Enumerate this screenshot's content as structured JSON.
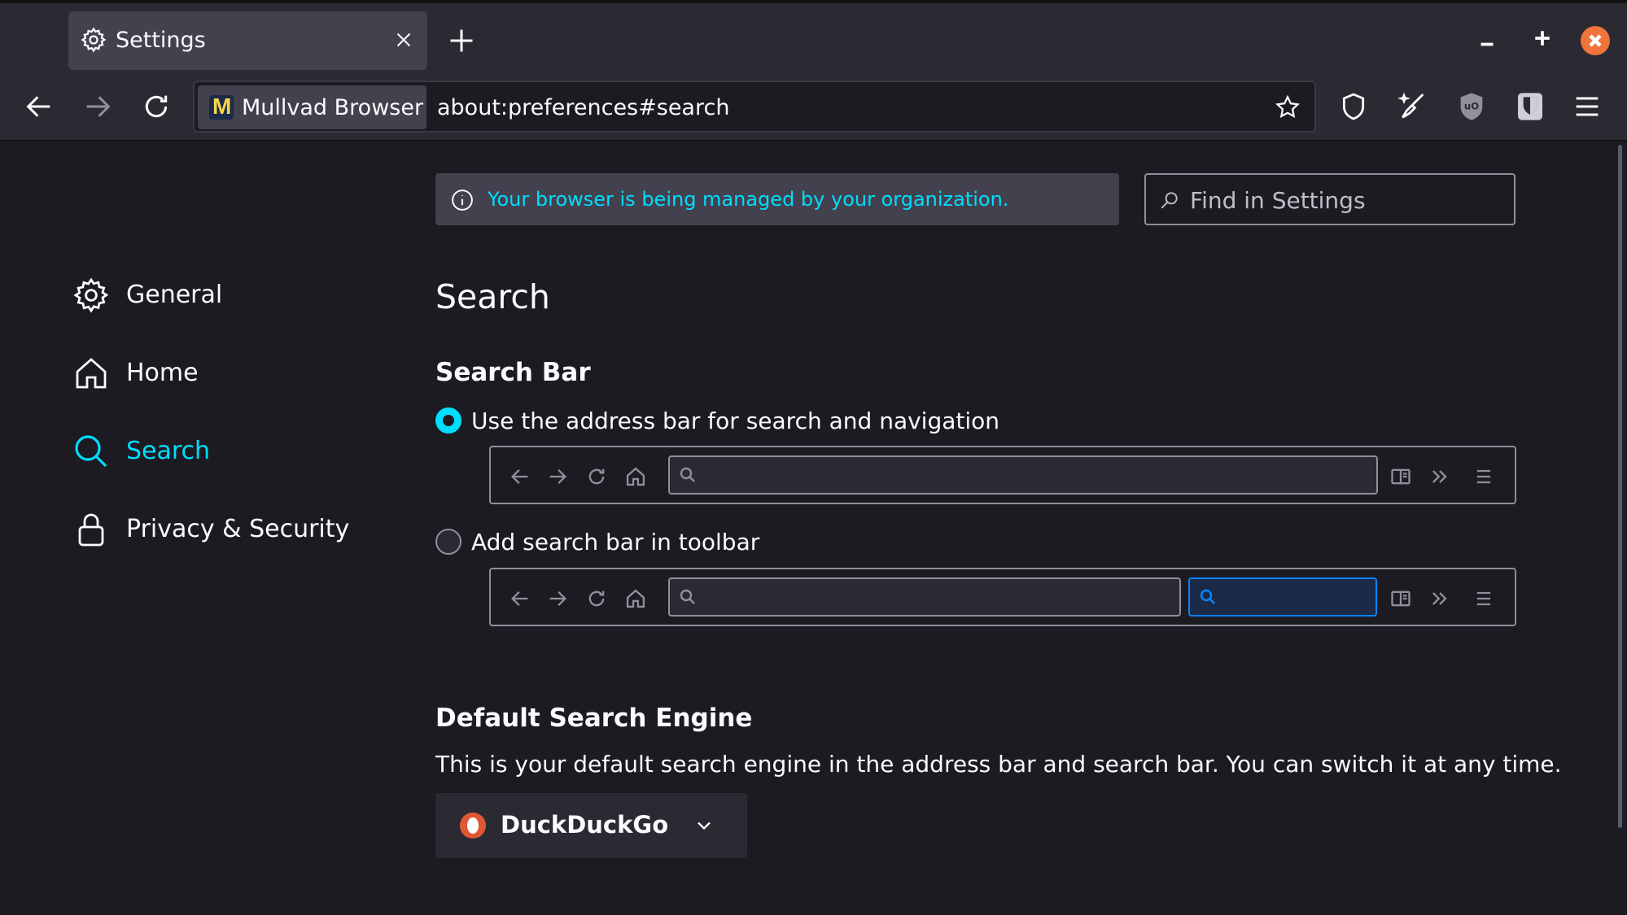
{
  "window": {
    "tab_title": "Settings"
  },
  "navbar": {
    "identity_label": "Mullvad Browser",
    "identity_logo": "M",
    "url": "about:preferences#search"
  },
  "notice": {
    "managed_text": "Your browser is being managed by your organization."
  },
  "find": {
    "placeholder": "Find in Settings"
  },
  "sidebar": {
    "items": [
      {
        "label": "General",
        "icon": "gear-icon",
        "active": false
      },
      {
        "label": "Home",
        "icon": "home-icon",
        "active": false
      },
      {
        "label": "Search",
        "icon": "search-icon",
        "active": true
      },
      {
        "label": "Privacy & Security",
        "icon": "lock-icon",
        "active": false
      }
    ]
  },
  "main": {
    "title": "Search",
    "search_bar": {
      "heading": "Search Bar",
      "options": [
        {
          "label": "Use the address bar for search and navigation",
          "checked": true
        },
        {
          "label": "Add search bar in toolbar",
          "checked": false
        }
      ]
    },
    "default_engine": {
      "heading": "Default Search Engine",
      "description": "This is your default search engine in the address bar and search bar. You can switch it at any time.",
      "selected": "DuckDuckGo"
    }
  },
  "colors": {
    "accent": "#00ddff",
    "background": "#1c1b22",
    "toolbar": "#2b2a33",
    "window_close": "#f0743a"
  }
}
